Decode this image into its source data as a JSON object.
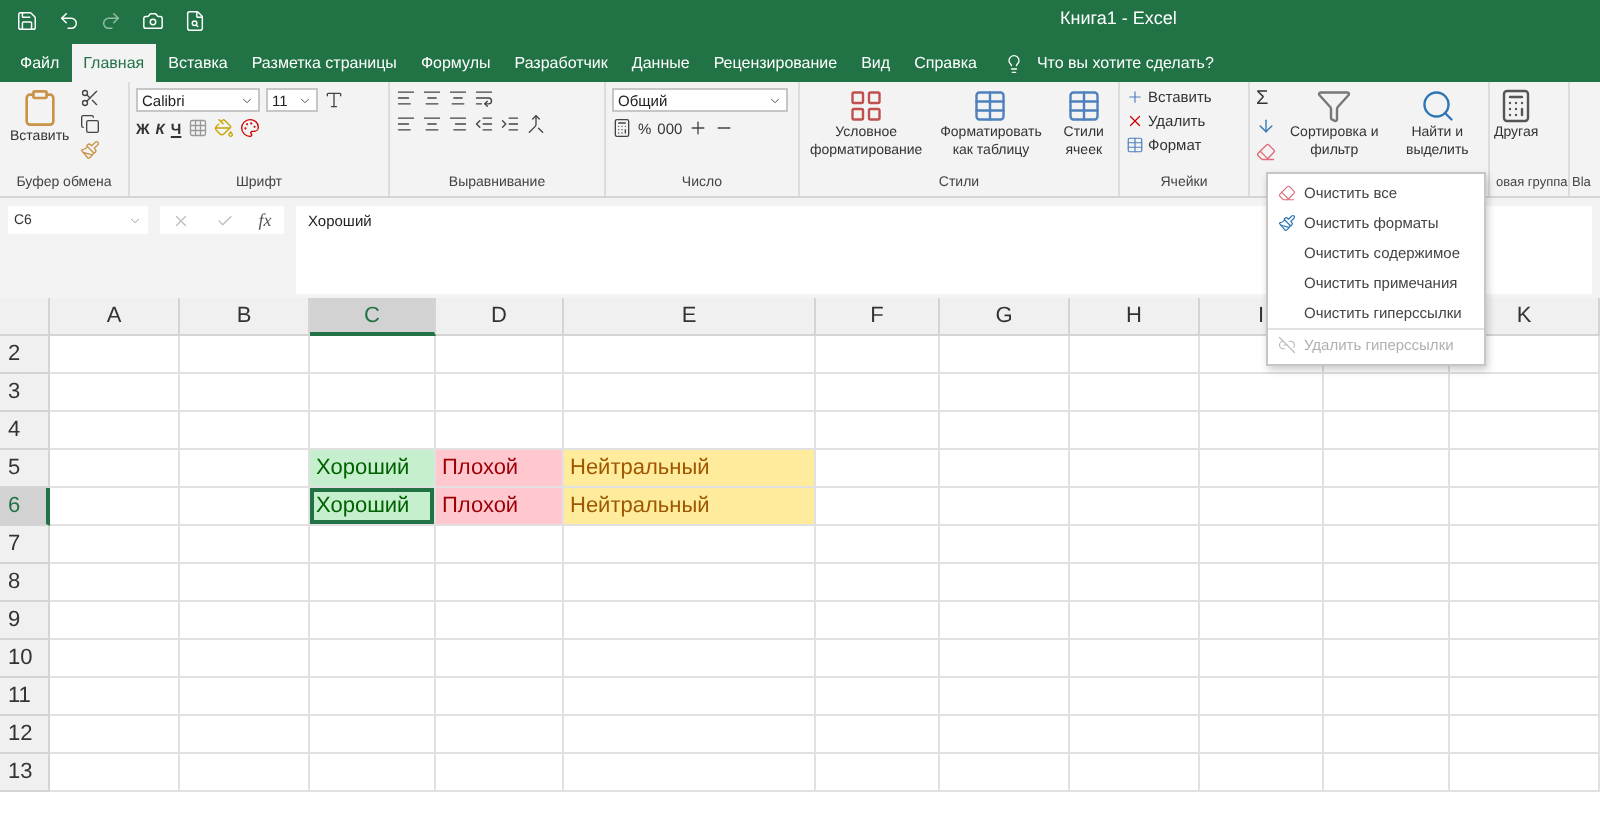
{
  "window": {
    "title": "Книга1 - Excel"
  },
  "tabs": [
    {
      "label": "Файл",
      "selected": false
    },
    {
      "label": "Главная",
      "selected": true
    },
    {
      "label": "Вставка",
      "selected": false
    },
    {
      "label": "Разметка страницы",
      "selected": false
    },
    {
      "label": "Формулы",
      "selected": false
    },
    {
      "label": "Разработчик",
      "selected": false
    },
    {
      "label": "Данные",
      "selected": false
    },
    {
      "label": "Рецензирование",
      "selected": false
    },
    {
      "label": "Вид",
      "selected": false
    },
    {
      "label": "Справка",
      "selected": false
    }
  ],
  "tell_me": {
    "placeholder": "Что вы хотите сделать?"
  },
  "ribbon": {
    "clipboard": {
      "paste": "Вставить",
      "label": "Буфер обмена"
    },
    "font": {
      "name": "Calibri",
      "size": "11",
      "bold": "Ж",
      "italic": "К",
      "underline": "Ч",
      "label": "Шрифт"
    },
    "alignment": {
      "label": "Выравнивание"
    },
    "number": {
      "format": "Общий",
      "percent": "%",
      "thousands": "000",
      "label": "Число"
    },
    "styles": {
      "buttons": [
        "Условное форматирование",
        "Форматировать как таблицу",
        "Стили ячеек"
      ],
      "label": "Стили"
    },
    "cells": {
      "buttons": [
        "Вставить",
        "Удалить",
        "Формат"
      ],
      "label": "Ячейки"
    },
    "editing": {
      "sum": "Σ",
      "sort": "Сортировка и фильтр",
      "find": "Найти и выделить"
    },
    "custom": {
      "button": "Другая",
      "label": "овая группа"
    },
    "cut_group": {
      "label": "Bla"
    }
  },
  "formula_bar": {
    "name_box": "C6",
    "fx": "fx",
    "value": "Хороший"
  },
  "clear_menu": [
    {
      "label": "Очистить все",
      "disabled": false,
      "kind": "eraser"
    },
    {
      "label": "Очистить форматы",
      "disabled": false,
      "kind": "formats"
    },
    {
      "label": "Очистить содержимое",
      "disabled": false,
      "kind": "plain"
    },
    {
      "label": "Очистить примечания",
      "disabled": false,
      "kind": "plain"
    },
    {
      "label": "Очистить гиперссылки",
      "disabled": false,
      "kind": "plain"
    },
    {
      "label": "Удалить гиперссылки",
      "disabled": true,
      "kind": "link"
    }
  ],
  "sheet": {
    "columns": [
      {
        "letter": "A",
        "selected": false
      },
      {
        "letter": "B",
        "selected": false
      },
      {
        "letter": "C",
        "selected": true
      },
      {
        "letter": "D",
        "selected": false
      },
      {
        "letter": "E",
        "selected": false
      },
      {
        "letter": "F",
        "selected": false
      },
      {
        "letter": "G",
        "selected": false
      },
      {
        "letter": "H",
        "selected": false
      },
      {
        "letter": "I",
        "selected": false
      },
      {},
      {
        "letter": "K",
        "selected": false
      }
    ],
    "rows": [
      {
        "number": "2",
        "selected": false
      },
      {
        "number": "3",
        "selected": false
      },
      {
        "number": "4",
        "selected": false
      },
      {
        "number": "5",
        "selected": false,
        "cells": [
          {
            "kind": "empty"
          },
          {
            "kind": "empty"
          },
          {
            "kind": "good",
            "text": "Хороший",
            "active": false
          },
          {
            "kind": "bad",
            "text": "Плохой",
            "active": false
          },
          {
            "kind": "neutral",
            "text": "Нейтральный",
            "active": false
          },
          {
            "kind": "empty"
          },
          {
            "kind": "empty"
          },
          {
            "kind": "empty"
          },
          {
            "kind": "empty"
          },
          {
            "kind": "empty"
          },
          {
            "kind": "empty"
          }
        ]
      },
      {
        "number": "6",
        "selected": true,
        "cells": [
          {
            "kind": "empty"
          },
          {
            "kind": "empty"
          },
          {
            "kind": "good",
            "text": "Хороший",
            "active": true
          },
          {
            "kind": "bad",
            "text": "Плохой",
            "active": false
          },
          {
            "kind": "neutral",
            "text": "Нейтральный",
            "active": false
          },
          {
            "kind": "empty"
          },
          {
            "kind": "empty"
          },
          {
            "kind": "empty"
          },
          {
            "kind": "empty"
          },
          {
            "kind": "empty"
          },
          {
            "kind": "empty"
          }
        ]
      },
      {
        "number": "7",
        "selected": false
      },
      {
        "number": "8",
        "selected": false
      },
      {
        "number": "9",
        "selected": false
      },
      {
        "number": "10",
        "selected": false
      },
      {
        "number": "11",
        "selected": false
      },
      {
        "number": "12",
        "selected": false
      },
      {
        "number": "13",
        "selected": false
      }
    ]
  }
}
